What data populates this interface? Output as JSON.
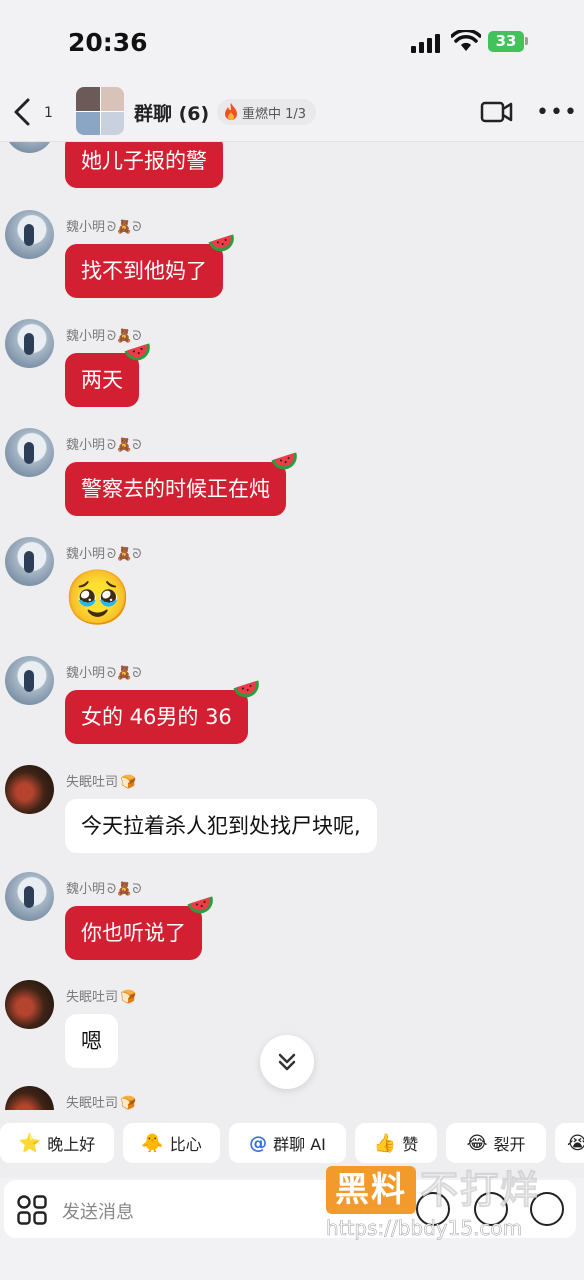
{
  "status_bar": {
    "time": "20:36",
    "battery": "33"
  },
  "header": {
    "unread_count": "1",
    "title": "群聊 (6)",
    "streak_label": "重燃中 1/3"
  },
  "messages": [
    {
      "sender": "",
      "text": "她儿子报的警",
      "style": "red"
    },
    {
      "sender": "魏小明",
      "text": "找不到他妈了",
      "style": "red"
    },
    {
      "sender": "魏小明",
      "text": "两天",
      "style": "red"
    },
    {
      "sender": "魏小明",
      "text": "警察去的时候正在炖",
      "style": "red"
    },
    {
      "sender": "魏小明",
      "emoji": "🥹",
      "style": "emoji"
    },
    {
      "sender": "魏小明",
      "text": "女的 46男的 36",
      "style": "red"
    },
    {
      "sender": "失眠吐司",
      "text": "今天拉着杀人犯到处找尸块呢,",
      "style": "white"
    },
    {
      "sender": "魏小明",
      "text": "你也听说了",
      "style": "red"
    },
    {
      "sender": "失眠吐司",
      "text": "嗯",
      "style": "white"
    },
    {
      "sender": "失眠吐司",
      "text": "",
      "style": "partial"
    }
  ],
  "quick_replies": [
    {
      "icon": "⭐",
      "label": "晚上好"
    },
    {
      "icon": "🐥",
      "label": "比心"
    },
    {
      "icon": "@",
      "label": "群聊 AI"
    },
    {
      "icon": "👍",
      "label": "赞"
    },
    {
      "icon": "😂",
      "label": "裂开"
    },
    {
      "icon": "😭",
      "label": ""
    }
  ],
  "input": {
    "placeholder": "发送消息"
  },
  "watermark": {
    "brand": "黑料",
    "slogan": "不打烊",
    "url": "https://bbdy15.com"
  },
  "colors": {
    "bubble_red": "#d21f31",
    "bubble_white": "#ffffff",
    "background": "#eeeef0"
  }
}
